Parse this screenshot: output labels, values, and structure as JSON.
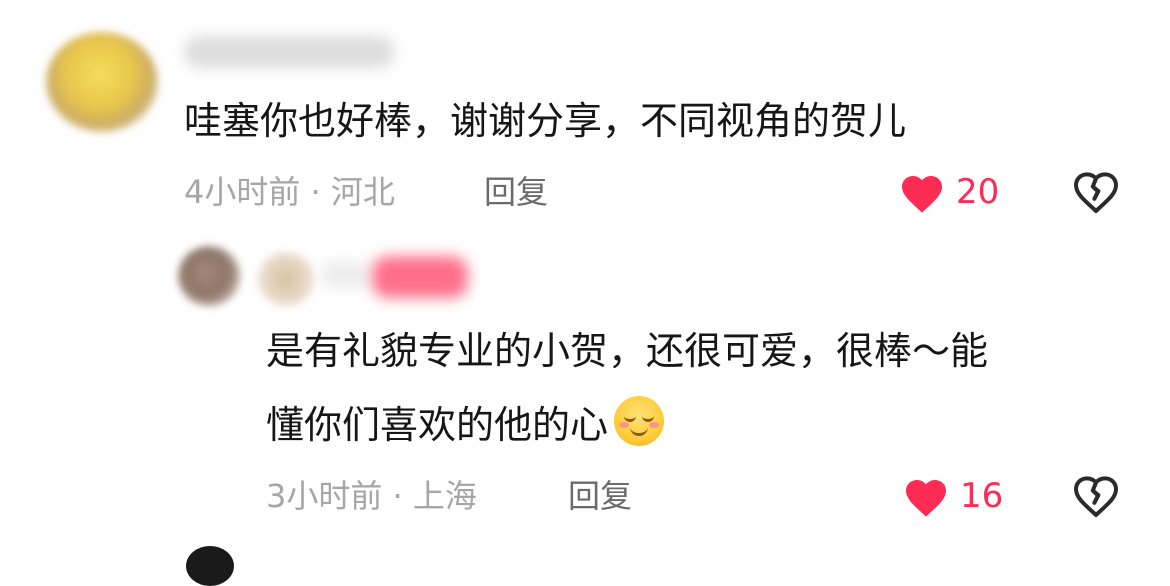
{
  "comments": [
    {
      "text": "哇塞你也好棒，谢谢分享，不同视角的贺儿",
      "time": "4小时前",
      "location": "河北",
      "separator": " · ",
      "reply_label": "回复",
      "likes": "20"
    },
    {
      "text_line1": "是有礼貌专业的小贺，还很可爱，很棒～能",
      "text_line2": "懂你们喜欢的他的心",
      "emoji": "smiling-face-emoji",
      "time": "3小时前",
      "location": "上海",
      "separator": " · ",
      "reply_label": "回复",
      "likes": "16"
    }
  ],
  "colors": {
    "like_red": "#fe2c55",
    "meta_gray": "#a6a6a6",
    "reply_gray": "#6b6b6b",
    "text": "#161616"
  }
}
